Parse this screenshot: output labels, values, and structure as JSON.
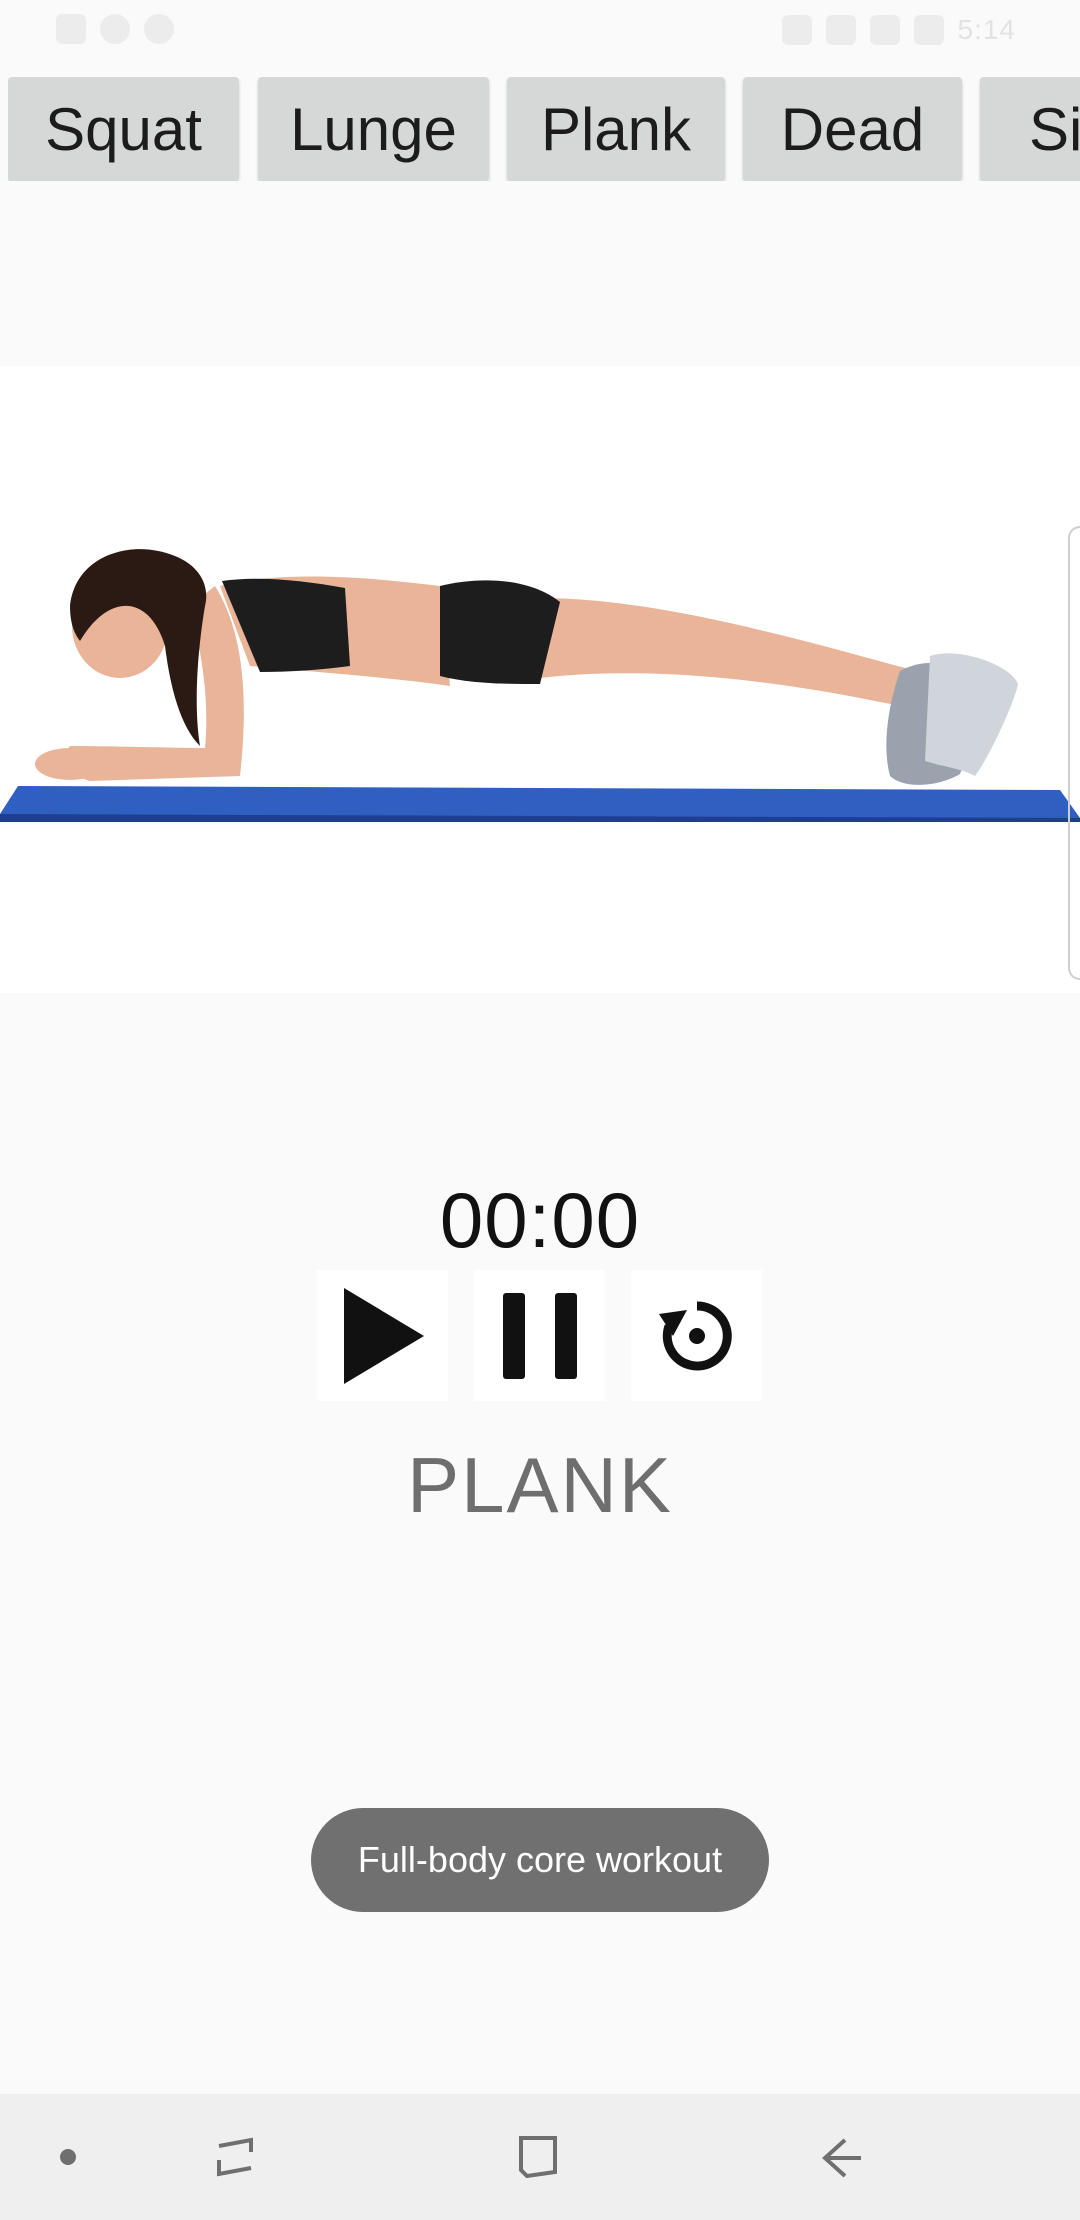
{
  "tabs": [
    {
      "label": "Squat"
    },
    {
      "label": "Lunge"
    },
    {
      "label": "Plank"
    },
    {
      "label": "Dead"
    },
    {
      "label": "Si"
    }
  ],
  "timer": {
    "value": "00:00"
  },
  "exercise": {
    "name": "PLANK"
  },
  "toast": {
    "text": "Full-body core workout"
  },
  "status_bar": {
    "time": "5:14"
  },
  "icons": {
    "play": "play-icon",
    "pause": "pause-icon",
    "reset": "reset-icon",
    "nav_dot": "dot-icon",
    "nav_recents": "recents-icon",
    "nav_home": "home-icon",
    "nav_back": "back-icon"
  },
  "colors": {
    "tab_background": "#d6d7d7",
    "toast_background": "#707070",
    "mat_blue": "#2f5fc1",
    "exercise_name": "#6e6e6e"
  }
}
